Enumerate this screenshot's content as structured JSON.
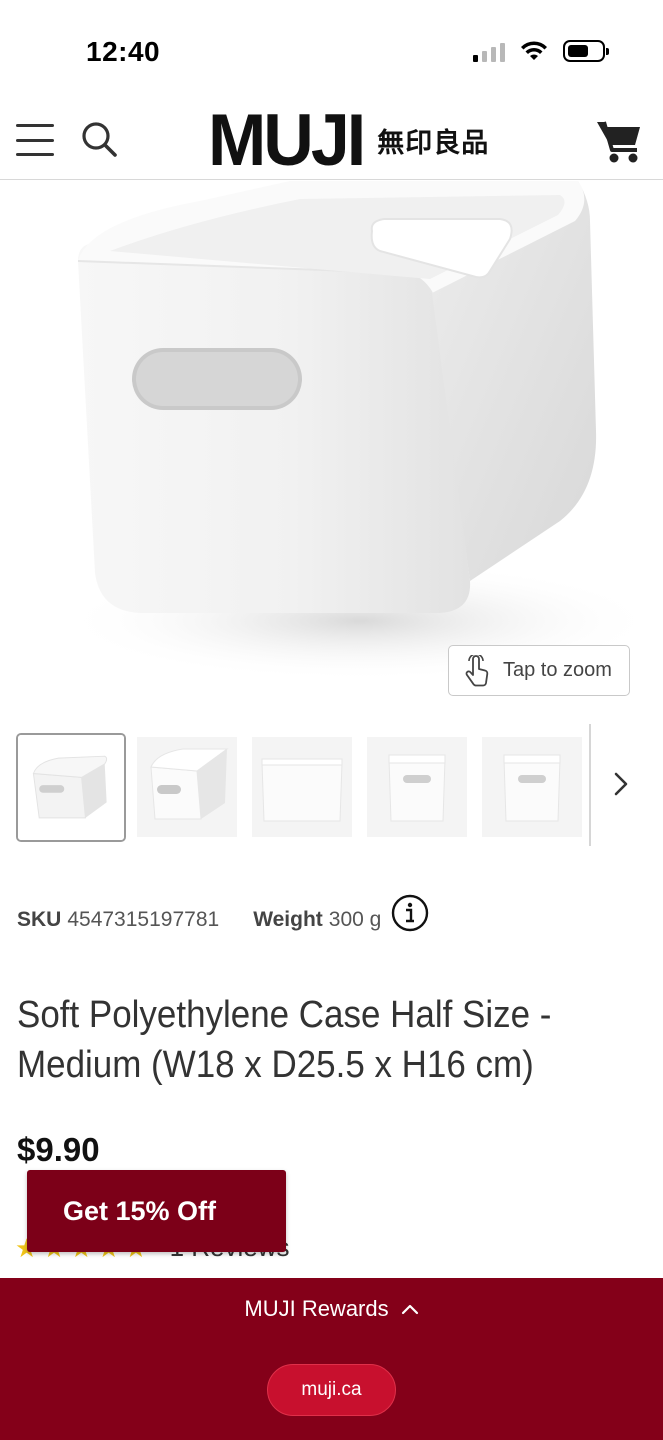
{
  "status_bar": {
    "time": "12:40",
    "icons": [
      "cellular-signal-icon",
      "wifi-icon",
      "battery-icon"
    ]
  },
  "header": {
    "logo_text": "MUJI",
    "logo_jp": "無印良品",
    "icons": [
      "hamburger-menu-icon",
      "search-icon",
      "cart-icon"
    ]
  },
  "gallery": {
    "zoom_label": "Tap to zoom",
    "thumbnail_count_visible": 5,
    "active_thumbnail": 1
  },
  "product": {
    "sku_label": "SKU",
    "sku": "4547315197781",
    "weight_label": "Weight",
    "weight": "300 g",
    "title": "Soft Polyethylene Case Half Size - Medium (W18 x D25.5 x H16 cm)",
    "price": "$9.90",
    "rating_stars": 5,
    "reviews": "1 Reviews"
  },
  "promo": {
    "label": "Get 15% Off"
  },
  "rewards": {
    "label": "MUJI Rewards",
    "url": "muji.ca"
  },
  "colors": {
    "brand_red": "#840019",
    "promo_red": "#7c0018",
    "pill_red": "#c8102e",
    "star": "#f0c419"
  }
}
